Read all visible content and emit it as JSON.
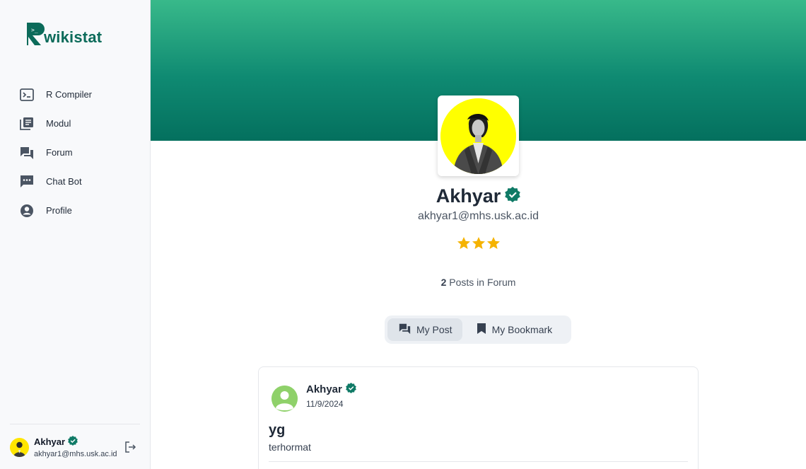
{
  "app": {
    "logo_text": "wikistat",
    "logo_prompt": ">_",
    "brand_color": "#0c6b5a"
  },
  "sidebar": {
    "items": [
      {
        "label": "R Compiler",
        "icon": "terminal-icon"
      },
      {
        "label": "Modul",
        "icon": "library-books-icon"
      },
      {
        "label": "Forum",
        "icon": "forum-icon"
      },
      {
        "label": "Chat Bot",
        "icon": "chat-dots-icon"
      },
      {
        "label": "Profile",
        "icon": "account-circle-icon"
      }
    ],
    "user": {
      "name": "Akhyar",
      "email": "akhyar1@mhs.usk.ac.id"
    }
  },
  "profile": {
    "name": "Akhyar",
    "email": "akhyar1@mhs.usk.ac.id",
    "stars": 3,
    "posts_count": "2",
    "posts_label": " Posts in Forum"
  },
  "tabs": [
    {
      "label": "My Post",
      "icon": "forum-icon",
      "active": true
    },
    {
      "label": "My Bookmark",
      "icon": "bookmark-icon",
      "active": false
    }
  ],
  "posts": [
    {
      "author": "Akhyar",
      "date": "11/9/2024",
      "title": "yg",
      "body": "terhormat"
    }
  ],
  "colors": {
    "accent": "#0f8a72",
    "verified": "#0f7a66",
    "star": "#f5b301",
    "avatar_bg": "#ffff00"
  }
}
